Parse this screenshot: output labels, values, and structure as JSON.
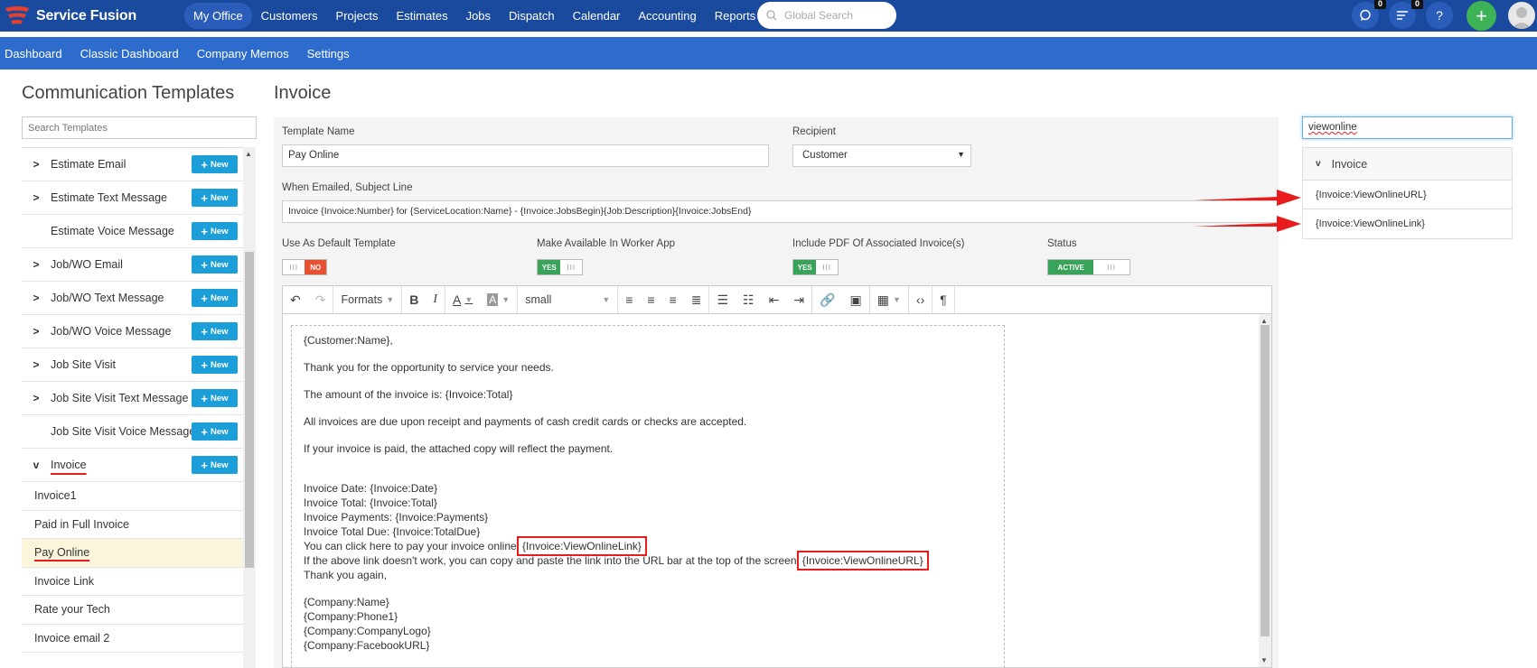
{
  "brand": {
    "name": "Service Fusion"
  },
  "topnav": {
    "items": [
      "My Office",
      "Customers",
      "Projects",
      "Estimates",
      "Jobs",
      "Dispatch",
      "Calendar",
      "Accounting",
      "Reports"
    ],
    "search_placeholder": "Global Search",
    "chat_count": "0",
    "notif_count": "0",
    "help": "?",
    "plus": "+"
  },
  "subnav": {
    "items": [
      "Dashboard",
      "Classic Dashboard",
      "Company Memos",
      "Settings"
    ]
  },
  "left": {
    "title": "Communication Templates",
    "search_placeholder": "Search Templates",
    "new_label": "New",
    "rows": [
      {
        "label": "Estimate Email",
        "chev": ">"
      },
      {
        "label": "Estimate Text Message",
        "chev": ">"
      },
      {
        "label": "Estimate Voice Message",
        "chev": ""
      },
      {
        "label": "Job/WO Email",
        "chev": ">"
      },
      {
        "label": "Job/WO Text Message",
        "chev": ">"
      },
      {
        "label": "Job/WO Voice Message",
        "chev": ">"
      },
      {
        "label": "Job Site Visit",
        "chev": ">"
      },
      {
        "label": "Job Site Visit Text Message",
        "chev": ">"
      },
      {
        "label": "Job Site Visit Voice Message",
        "chev": ""
      },
      {
        "label": "Invoice",
        "chev": "v"
      }
    ],
    "subitems": [
      "Invoice1",
      "Paid in Full Invoice",
      "Pay Online",
      "Invoice Link",
      "Rate your Tech",
      "Invoice email 2"
    ]
  },
  "main": {
    "title": "Invoice",
    "template_name_label": "Template Name",
    "template_name_value": "Pay Online",
    "recipient_label": "Recipient",
    "recipient_value": "Customer",
    "subject_label": "When Emailed, Subject Line",
    "subject_value": "Invoice {Invoice:Number} for {ServiceLocation:Name} - {Invoice:JobsBegin}{Job:Description}{Invoice:JobsEnd}",
    "default_label": "Use As Default Template",
    "default_value": "NO",
    "worker_label": "Make Available In Worker App",
    "worker_value": "YES",
    "pdf_label": "Include PDF Of Associated Invoice(s)",
    "pdf_value": "YES",
    "status_label": "Status",
    "status_value": "ACTIVE",
    "toolbar": {
      "formats": "Formats",
      "size": "small"
    },
    "body": {
      "l1": "{Customer:Name},",
      "l2": "Thank you for the opportunity to service your needs.",
      "l3": "The amount of the invoice is: {Invoice:Total}",
      "l4": "All invoices are due upon receipt and payments of cash credit cards or checks are accepted.",
      "l5": "If your invoice is paid, the attached copy will reflect the payment.",
      "l6": "Invoice Date: {Invoice:Date}",
      "l7": "Invoice Total: {Invoice:Total}",
      "l8": "Invoice Payments: {Invoice:Payments}",
      "l9": "Invoice Total Due: {Invoice:TotalDue}",
      "l10a": "You can click here to pay your invoice online",
      "l10b": "{Invoice:ViewOnlineLink}",
      "l11a": "If the above link doesn't work, you can copy and paste the link into the URL bar at the top of the screen!",
      "l11b": "{Invoice:ViewOnlineURL}",
      "l12": "Thank you again,",
      "l13": "{Company:Name}",
      "l14": "{Company:Phone1}",
      "l15": "{Company:CompanyLogo}",
      "l16": "{Company:FacebookURL}"
    }
  },
  "right": {
    "search_value": "viewonline",
    "group": "Invoice",
    "items": [
      "{Invoice:ViewOnlineURL}",
      "{Invoice:ViewOnlineLink}"
    ]
  },
  "colors": {
    "nav": "#1a4a9e",
    "subnav": "#2d6ccc",
    "new_btn": "#1c9ed9",
    "yes": "#3aa35a",
    "no": "#e8502f",
    "highlight": "#e81c1c"
  }
}
